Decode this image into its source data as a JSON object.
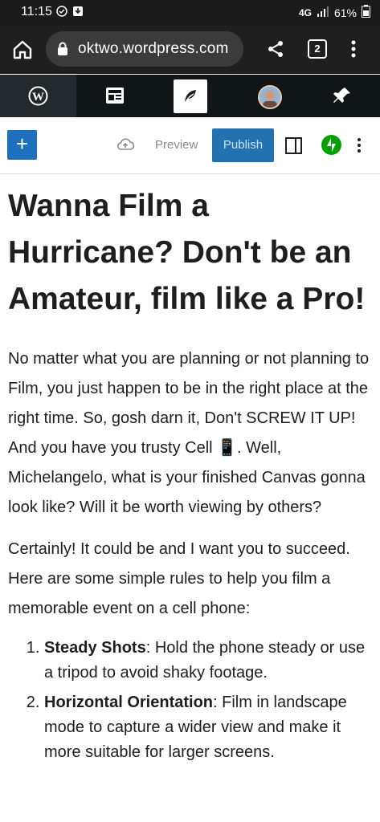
{
  "status_bar": {
    "time": "11:15",
    "network": "4G",
    "battery": "61%"
  },
  "browser": {
    "url": "oktwo.wordpress.com",
    "tab_count": "2"
  },
  "admin_bar": {
    "items": [
      "wordpress-logo",
      "reader",
      "my-site",
      "avatar",
      "notifications"
    ]
  },
  "editor_toolbar": {
    "preview_label": "Preview",
    "publish_label": "Publish"
  },
  "post": {
    "title": "Wanna Film a Hurricane?  Don't be an Amateur, film like a Pro!",
    "paragraph1": "No matter what you are planning or not planning to Film, you just happen to be in the right place at the right time.  So, gosh darn it, Don't SCREW IT UP!  And you have you trusty Cell 📱.  Well, Michelangelo, what is your finished Canvas gonna look like?  Will it be worth viewing by others?",
    "paragraph2": "Certainly! It could be and I want you to succeed. Here are some simple rules to help you film a memorable event on a cell phone:",
    "rules": [
      {
        "term": "Steady Shots",
        "text": ": Hold the phone steady or use a tripod to avoid shaky footage."
      },
      {
        "term": "Horizontal Orientation",
        "text": ": Film in landscape mode to capture a wider view and make it more suitable for larger screens."
      }
    ]
  },
  "colors": {
    "publish_blue": "#2271b1",
    "add_blue": "#1e72bd",
    "jetpack_green": "#069e08",
    "admin_bar_bg": "#101517"
  }
}
